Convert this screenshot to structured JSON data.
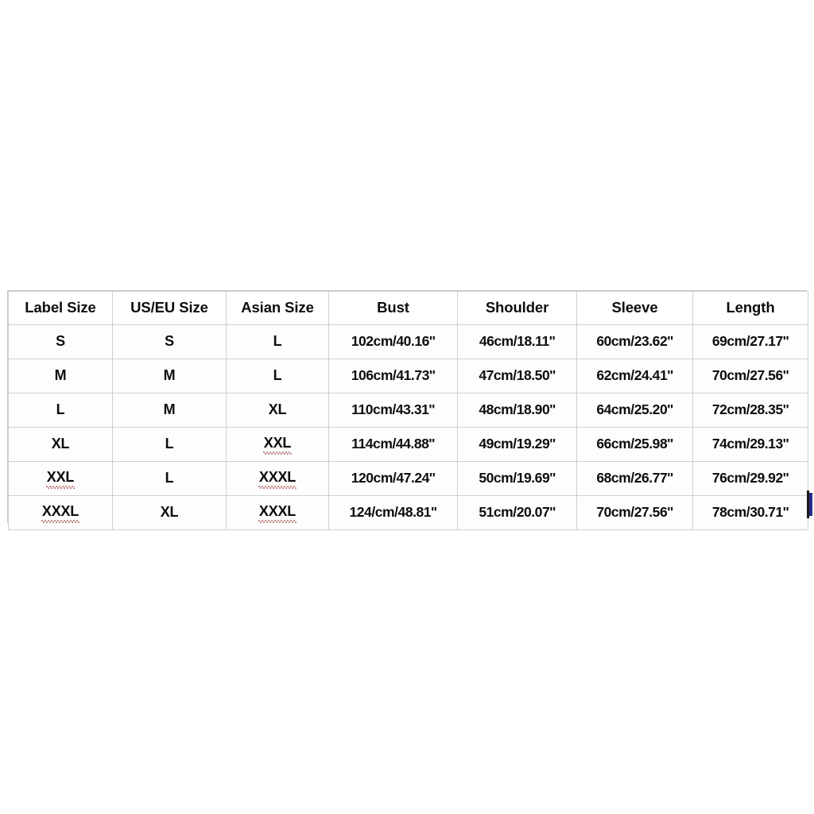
{
  "page": {
    "background_color": "#ffffff",
    "table_border_color": "#cfcfcf",
    "text_color": "#0d0d0d",
    "spellcheck_underline_color": "#8b1c20",
    "edge_artifact_color": "#2a2a86"
  },
  "table": {
    "name": "size-chart",
    "columns": [
      "Label Size",
      "US/EU Size",
      "Asian Size",
      "Bust",
      "Shoulder",
      "Sleeve",
      "Length"
    ],
    "rows": [
      {
        "label_size": "S",
        "us_eu_size": "S",
        "asian_size": "L",
        "bust": "102cm/40.16''",
        "shoulder": "46cm/18.11''",
        "sleeve": "60cm/23.62''",
        "length": "69cm/27.17''",
        "misspelled": []
      },
      {
        "label_size": "M",
        "us_eu_size": "M",
        "asian_size": "L",
        "bust": "106cm/41.73''",
        "shoulder": "47cm/18.50''",
        "sleeve": "62cm/24.41''",
        "length": "70cm/27.56''",
        "misspelled": []
      },
      {
        "label_size": "L",
        "us_eu_size": "M",
        "asian_size": "XL",
        "bust": "110cm/43.31''",
        "shoulder": "48cm/18.90''",
        "sleeve": "64cm/25.20''",
        "length": "72cm/28.35''",
        "misspelled": []
      },
      {
        "label_size": "XL",
        "us_eu_size": "L",
        "asian_size": "XXL",
        "bust": "114cm/44.88''",
        "shoulder": "49cm/19.29''",
        "sleeve": "66cm/25.98''",
        "length": "74cm/29.13''",
        "misspelled": [
          "asian_size"
        ]
      },
      {
        "label_size": "XXL",
        "us_eu_size": "L",
        "asian_size": "XXXL",
        "bust": "120cm/47.24''",
        "shoulder": "50cm/19.69''",
        "sleeve": "68cm/26.77''",
        "length": "76cm/29.92''",
        "misspelled": [
          "label_size",
          "asian_size"
        ]
      },
      {
        "label_size": "XXXL",
        "us_eu_size": "XL",
        "asian_size": "XXXL",
        "bust": "124/cm/48.81''",
        "shoulder": "51cm/20.07''",
        "sleeve": "70cm/27.56''",
        "length": "78cm/30.71''",
        "misspelled": [
          "label_size",
          "asian_size"
        ]
      }
    ]
  }
}
